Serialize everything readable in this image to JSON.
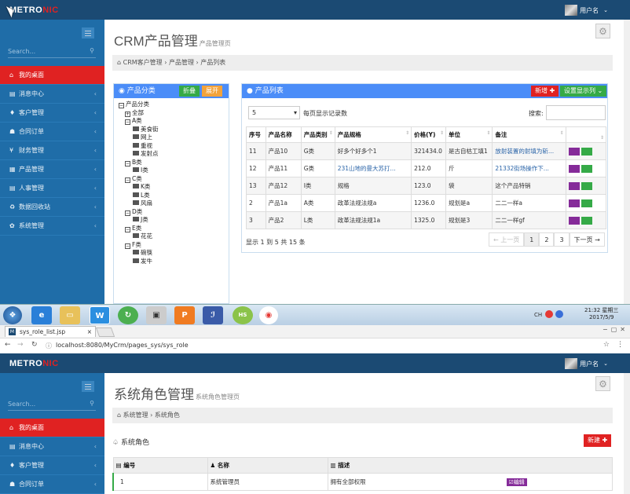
{
  "top": {
    "logo_a": "METRO",
    "logo_b": "NIC",
    "user": "用户名",
    "search_placeholder": "Search...",
    "menu": [
      {
        "icon": "home-icon",
        "glyph": "⌂",
        "label": "我的桌面",
        "active": true
      },
      {
        "icon": "message-icon",
        "glyph": "▤",
        "label": "消息中心"
      },
      {
        "icon": "customer-icon",
        "glyph": "♦",
        "label": "客户管理"
      },
      {
        "icon": "contract-icon",
        "glyph": "☗",
        "label": "合同订单"
      },
      {
        "icon": "finance-icon",
        "glyph": "¥",
        "label": "财务管理"
      },
      {
        "icon": "product-icon",
        "glyph": "▦",
        "label": "产品管理"
      },
      {
        "icon": "hr-icon",
        "glyph": "▤",
        "label": "人事管理"
      },
      {
        "icon": "recycle-icon",
        "glyph": "♻",
        "label": "数据回收站"
      },
      {
        "icon": "settings-icon",
        "glyph": "✿",
        "label": "系统管理"
      }
    ],
    "page_title": "CRM产品管理",
    "page_subtitle": "产品管理页",
    "breadcrumb": [
      "CRM客户管理",
      "产品管理",
      "产品列表"
    ],
    "category_panel": {
      "title": "产品分类",
      "collapse": "折叠",
      "expand": "展开",
      "tree": [
        {
          "level": 0,
          "kind": "box",
          "sign": "−",
          "label": "产品分类"
        },
        {
          "level": 1,
          "kind": "box",
          "sign": "+",
          "label": "全部"
        },
        {
          "level": 1,
          "kind": "box",
          "sign": "−",
          "label": "A类"
        },
        {
          "level": 2,
          "kind": "file",
          "label": "美食街"
        },
        {
          "level": 2,
          "kind": "file",
          "label": "网上"
        },
        {
          "level": 2,
          "kind": "file",
          "label": "重视"
        },
        {
          "level": 2,
          "kind": "file",
          "label": "发射点"
        },
        {
          "level": 1,
          "kind": "box",
          "sign": "−",
          "label": "B类"
        },
        {
          "level": 2,
          "kind": "file",
          "label": "I类"
        },
        {
          "level": 1,
          "kind": "box",
          "sign": "−",
          "label": "C类"
        },
        {
          "level": 2,
          "kind": "file",
          "label": "K类"
        },
        {
          "level": 2,
          "kind": "file",
          "label": "L类"
        },
        {
          "level": 2,
          "kind": "file",
          "label": "风扇"
        },
        {
          "level": 1,
          "kind": "box",
          "sign": "−",
          "label": "D类"
        },
        {
          "level": 2,
          "kind": "file",
          "label": "J类"
        },
        {
          "level": 1,
          "kind": "box",
          "sign": "−",
          "label": "E类"
        },
        {
          "level": 2,
          "kind": "file",
          "label": "花花"
        },
        {
          "level": 1,
          "kind": "box",
          "sign": "−",
          "label": "F类"
        },
        {
          "level": 2,
          "kind": "file",
          "label": "碗筷"
        },
        {
          "level": 2,
          "kind": "file",
          "label": "发牛"
        }
      ]
    },
    "list_panel": {
      "title": "产品列表",
      "add": "新增",
      "columns_btn": "设置显示列",
      "page_size": "5",
      "page_size_label": "每页显示记录数",
      "search_label": "搜索:",
      "headers": [
        "序号",
        "产品名称",
        "产品类别",
        "产品规格",
        "价格(Y)",
        "单位",
        "备注",
        ""
      ],
      "rows": [
        [
          "11",
          "产品10",
          "G类",
          "好多个好多个1",
          "321434.0",
          "是古自枯工填1",
          "放射装置的射填为斩...",
          "blue"
        ],
        [
          "12",
          "产品11",
          "G类",
          "231山地的曼大苏打...",
          "212.0",
          "斤",
          "21332街场操作下...",
          "blue"
        ],
        [
          "13",
          "产品12",
          "I类",
          "规格",
          "123.0",
          "袋",
          "这个产品特销",
          ""
        ],
        [
          "2",
          "产品1a",
          "A类",
          "政革法规法规a",
          "1236.0",
          "规划是a",
          "二二一样a",
          ""
        ],
        [
          "3",
          "产品2",
          "L类",
          "政革法规法规1a",
          "1325.0",
          "规划是3",
          "二二一样gf",
          ""
        ]
      ],
      "info": "显示 1 到 5 共 15 条",
      "prev": "← 上一页",
      "pages": [
        "1",
        "2",
        "3"
      ],
      "next": "下一页 →"
    }
  },
  "taskbar": {
    "clock_time": "21:32 星期三",
    "clock_date": "2017/5/9",
    "tray": "CH"
  },
  "browser": {
    "tab_title": "sys_role_list.jsp",
    "tab_close": "×",
    "url": "localhost:8080/MyCrm/pages_sys/sys_role"
  },
  "bottom": {
    "logo_a": "METRO",
    "logo_b": "NIC",
    "user": "用户名",
    "search_placeholder": "Search...",
    "menu": [
      {
        "icon": "home-icon",
        "glyph": "⌂",
        "label": "我的桌面",
        "active": true
      },
      {
        "icon": "message-icon",
        "glyph": "▤",
        "label": "消息中心"
      },
      {
        "icon": "customer-icon",
        "glyph": "♦",
        "label": "客户管理"
      },
      {
        "icon": "contract-icon",
        "glyph": "☗",
        "label": "合同订单"
      }
    ],
    "page_title": "系统角色管理",
    "page_subtitle": "系统角色管理页",
    "breadcrumb": [
      "系统管理",
      "系统角色"
    ],
    "section_title": "系统角色",
    "new_btn": "新建",
    "headers": [
      "编号",
      "名称",
      "描述"
    ],
    "rows": [
      [
        "1",
        "系统管理员",
        "拥有全部权限",
        "编辑"
      ]
    ]
  },
  "colors": {
    "header": "#1b4a73",
    "sidebar": "#1f6da8",
    "active": "#e02222",
    "panel_header": "#4b8df8",
    "green": "#35aa47",
    "orange": "#f3a33b",
    "purple": "#852b99"
  }
}
